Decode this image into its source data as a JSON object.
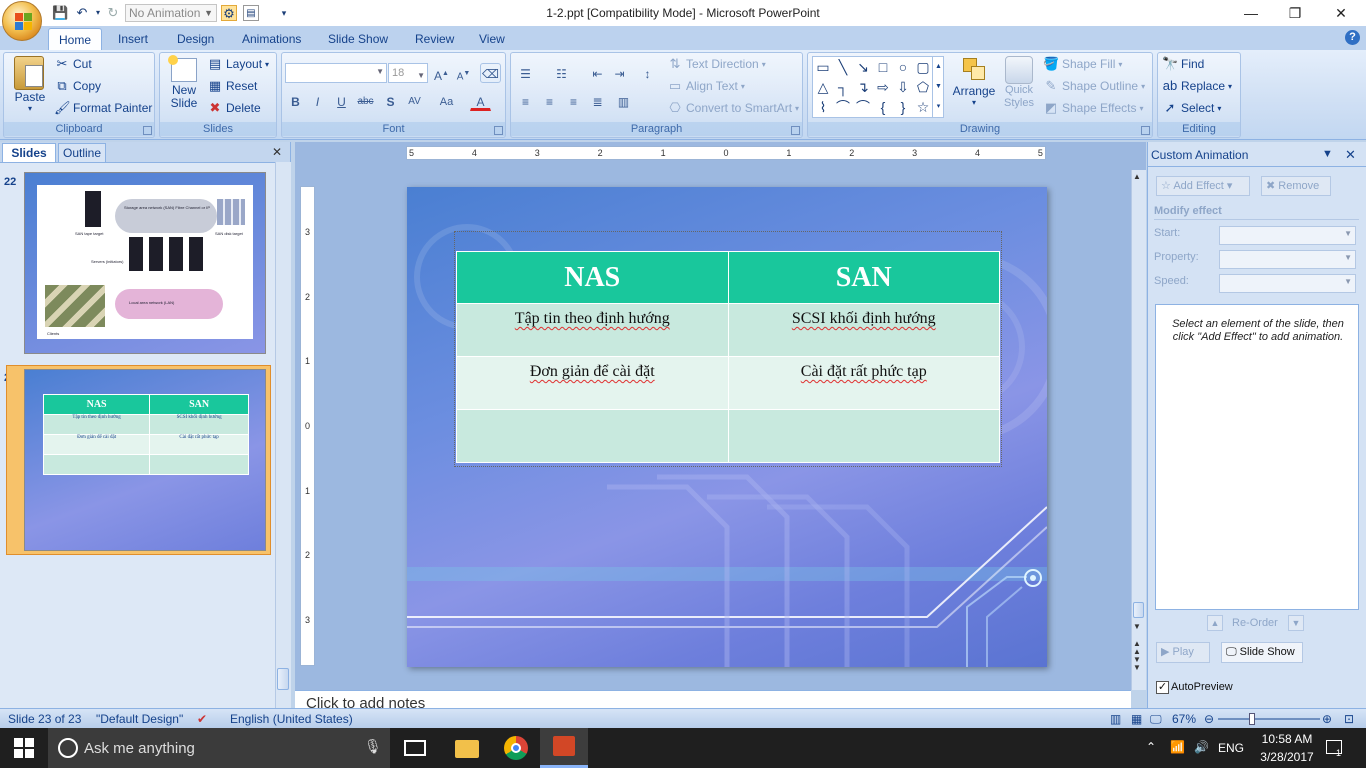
{
  "window": {
    "title": "1-2.ppt [Compatibility Mode] - Microsoft PowerPoint",
    "qat_animation_value": "No Animation"
  },
  "ribbon": {
    "tabs": [
      "Home",
      "Insert",
      "Design",
      "Animations",
      "Slide Show",
      "Review",
      "View"
    ],
    "active_tab": "Home",
    "clipboard": {
      "paste": "Paste",
      "cut": "Cut",
      "copy": "Copy",
      "format_painter": "Format Painter",
      "label": "Clipboard"
    },
    "slides": {
      "new_slide_1": "New",
      "new_slide_2": "Slide",
      "layout": "Layout",
      "reset": "Reset",
      "delete": "Delete",
      "label": "Slides"
    },
    "font": {
      "font_size": "18",
      "label": "Font"
    },
    "paragraph": {
      "text_direction": "Text Direction",
      "align_text": "Align Text",
      "convert_smartart": "Convert to SmartArt",
      "label": "Paragraph"
    },
    "drawing": {
      "arrange": "Arrange",
      "quick_styles_1": "Quick",
      "quick_styles_2": "Styles",
      "shape_fill": "Shape Fill",
      "shape_outline": "Shape Outline",
      "shape_effects": "Shape Effects",
      "label": "Drawing"
    },
    "editing": {
      "find": "Find",
      "replace": "Replace",
      "select": "Select",
      "label": "Editing"
    }
  },
  "left_panel": {
    "tab_slides": "Slides",
    "tab_outline": "Outline",
    "thumbs": [
      {
        "number": "22"
      },
      {
        "number": "23"
      }
    ],
    "thumb22_labels": {
      "cloud1": "Storage area network (SAN) Fibre Channel or IP",
      "tape": "SAN tape target",
      "disk": "SAN disk target",
      "servers": "Servers (initiators)",
      "lan": "Local area network (LAN)",
      "clients": "Clients"
    }
  },
  "slide": {
    "table": {
      "headers": [
        "NAS",
        "SAN"
      ],
      "rows": [
        [
          "Tập tin theo định hướng",
          "SCSI khối định hướng"
        ],
        [
          "Đơn giản để cài đặt",
          "Cài đặt rất phức tạp"
        ],
        [
          "",
          ""
        ]
      ]
    },
    "ruler_h": [
      "5",
      "4",
      "3",
      "2",
      "1",
      "0",
      "1",
      "2",
      "3",
      "4",
      "5"
    ],
    "ruler_v": [
      "3",
      "2",
      "1",
      "0",
      "1",
      "2",
      "3"
    ]
  },
  "notes": {
    "placeholder": "Click to add notes"
  },
  "anim_pane": {
    "title": "Custom Animation",
    "add_effect": "Add Effect",
    "remove": "Remove",
    "modify_effect": "Modify effect",
    "start": "Start:",
    "property": "Property:",
    "speed": "Speed:",
    "hint": "Select an element of the slide, then click \"Add Effect\" to add animation.",
    "reorder": "Re-Order",
    "play": "Play",
    "slide_show": "Slide Show",
    "autopreview": "AutoPreview"
  },
  "statusbar": {
    "slide_of": "Slide 23 of 23",
    "theme": "\"Default Design\"",
    "language": "English (United States)",
    "zoom": "67%"
  },
  "taskbar": {
    "search_placeholder": "Ask me anything",
    "lang": "ENG",
    "time": "10:58 AM",
    "date": "3/28/2017",
    "notifications": "1"
  },
  "colors": {
    "table_header": "#19c79c",
    "table_band_dark": "#c8e9de",
    "table_band_light": "#e4f4ee",
    "ribbon_bg": "#cfdff4",
    "taskbar": "#1f1f1f"
  }
}
